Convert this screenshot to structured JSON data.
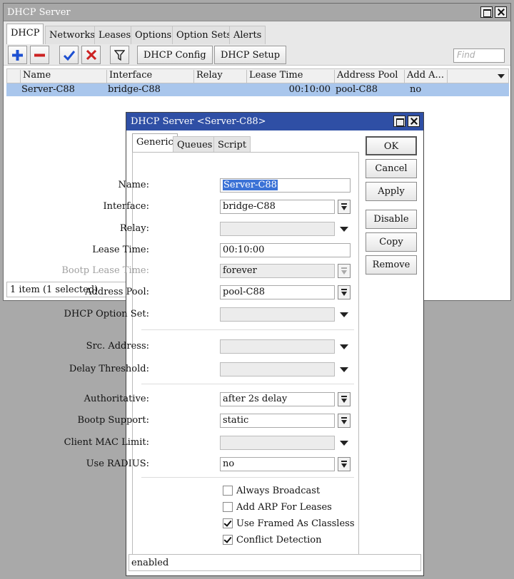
{
  "main_window": {
    "title": "DHCP Server",
    "tabs": [
      "DHCP",
      "Networks",
      "Leases",
      "Options",
      "Option Sets",
      "Alerts"
    ],
    "toolbar": {
      "dhcp_config": "DHCP Config",
      "dhcp_setup": "DHCP Setup",
      "find_placeholder": "Find"
    },
    "columns": [
      "Name",
      "Interface",
      "Relay",
      "Lease Time",
      "Address Pool",
      "Add A..."
    ],
    "rows": [
      {
        "name": "Server-C88",
        "interface": "bridge-C88",
        "relay": "",
        "lease_time": "00:10:00",
        "address_pool": "pool-C88",
        "add_arp": "no"
      }
    ],
    "status": "1 item (1 selected)"
  },
  "dialog": {
    "title": "DHCP Server <Server-C88>",
    "tabs": [
      "Generic",
      "Queues",
      "Script"
    ],
    "fields": {
      "name": {
        "label": "Name:",
        "value": "Server-C88"
      },
      "interface": {
        "label": "Interface:",
        "value": "bridge-C88"
      },
      "relay": {
        "label": "Relay:",
        "value": ""
      },
      "lease_time": {
        "label": "Lease Time:",
        "value": "00:10:00"
      },
      "bootp_lease_time": {
        "label": "Bootp Lease Time:",
        "value": "forever"
      },
      "address_pool": {
        "label": "Address Pool:",
        "value": "pool-C88"
      },
      "dhcp_option_set": {
        "label": "DHCP Option Set:",
        "value": ""
      },
      "src_address": {
        "label": "Src. Address:",
        "value": ""
      },
      "delay_threshold": {
        "label": "Delay Threshold:",
        "value": ""
      },
      "authoritative": {
        "label": "Authoritative:",
        "value": "after 2s delay"
      },
      "bootp_support": {
        "label": "Bootp Support:",
        "value": "static"
      },
      "client_mac_limit": {
        "label": "Client MAC Limit:",
        "value": ""
      },
      "use_radius": {
        "label": "Use RADIUS:",
        "value": "no"
      }
    },
    "checkboxes": [
      {
        "label": "Always Broadcast",
        "checked": false
      },
      {
        "label": "Add ARP For Leases",
        "checked": false
      },
      {
        "label": "Use Framed As Classless",
        "checked": true
      },
      {
        "label": "Conflict Detection",
        "checked": true
      }
    ],
    "buttons": {
      "ok": "OK",
      "cancel": "Cancel",
      "apply": "Apply",
      "disable": "Disable",
      "copy": "Copy",
      "remove": "Remove"
    },
    "status": "enabled"
  },
  "colors": {
    "selection": "#a9c6ec",
    "dialog_title": "#2f4fa5",
    "add_icon": "#1c4fd1",
    "remove_icon": "#cc2222"
  },
  "icons": [
    "add-icon",
    "remove-icon",
    "enable-check-icon",
    "disable-x-icon",
    "filter-icon"
  ]
}
